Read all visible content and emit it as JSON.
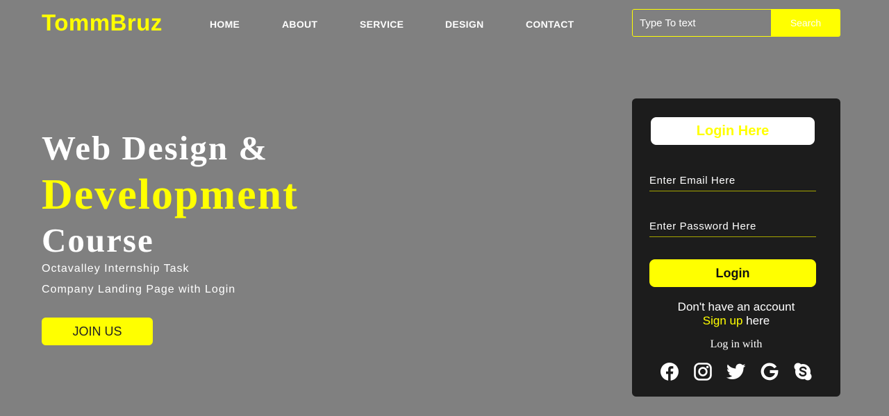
{
  "header": {
    "logo": "TommBruz",
    "nav": [
      "HOME",
      "ABOUT",
      "SERVICE",
      "DESIGN",
      "CONTACT"
    ],
    "search": {
      "placeholder": "Type To text",
      "button_label": "Search"
    }
  },
  "hero": {
    "line1": "Web Design &",
    "line2": "Development",
    "line3": "Course",
    "sub1": "Octavalley Internship Task",
    "sub2": "Company Landing Page with Login",
    "cta": "JOIN US"
  },
  "login": {
    "title": "Login Here",
    "email_placeholder": "Enter Email Here",
    "password_placeholder": "Enter Password Here",
    "button": "Login",
    "no_account": "Don't have an account",
    "signup_link": "Sign up",
    "signup_suffix": " here",
    "log_in_with": "Log in with",
    "socials": [
      "facebook-icon",
      "instagram-icon",
      "twitter-icon",
      "google-icon",
      "skype-icon"
    ]
  },
  "colors": {
    "background": "#808080",
    "accent": "#ffff00",
    "card": "#1c1c1c",
    "text": "#ffffff"
  }
}
